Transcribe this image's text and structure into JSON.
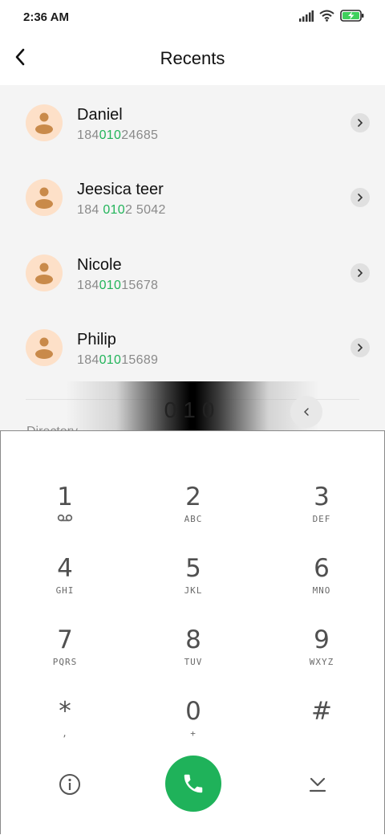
{
  "status": {
    "time": "2:36 AM",
    "icons": [
      "signal-icon",
      "wifi-icon",
      "battery-charging-icon"
    ]
  },
  "header": {
    "title": "Recents",
    "back_icon": "arrow-left-icon"
  },
  "contacts": [
    {
      "name": "Daniel",
      "number_pre": "184",
      "number_hl": "010",
      "number_post": "24685"
    },
    {
      "name": "Jeesica teer",
      "number_pre": "184 ",
      "number_hl": "010",
      "number_post": "2 5042"
    },
    {
      "name": "Nicole",
      "number_pre": "184",
      "number_hl": "010",
      "number_post": "15678"
    },
    {
      "name": "Philip",
      "number_pre": "184",
      "number_hl": "010",
      "number_post": "15689"
    }
  ],
  "section": {
    "directory": "Directory"
  },
  "input": {
    "digits": "010"
  },
  "dialpad": {
    "keys": [
      {
        "num": "1",
        "sub": ""
      },
      {
        "num": "2",
        "sub": "ABC"
      },
      {
        "num": "3",
        "sub": "DEF"
      },
      {
        "num": "4",
        "sub": "GHI"
      },
      {
        "num": "5",
        "sub": "JKL"
      },
      {
        "num": "6",
        "sub": "MNO"
      },
      {
        "num": "7",
        "sub": "PQRS"
      },
      {
        "num": "8",
        "sub": "TUV"
      },
      {
        "num": "9",
        "sub": "WXYZ"
      },
      {
        "num": "*",
        "sub": ","
      },
      {
        "num": "0",
        "sub": "+"
      },
      {
        "num": "#",
        "sub": ""
      }
    ]
  },
  "colors": {
    "accent": "#1fb25a",
    "highlight": "#22b45a",
    "avatar_bg": "#fde0c8",
    "avatar_fg": "#c98a4a"
  }
}
